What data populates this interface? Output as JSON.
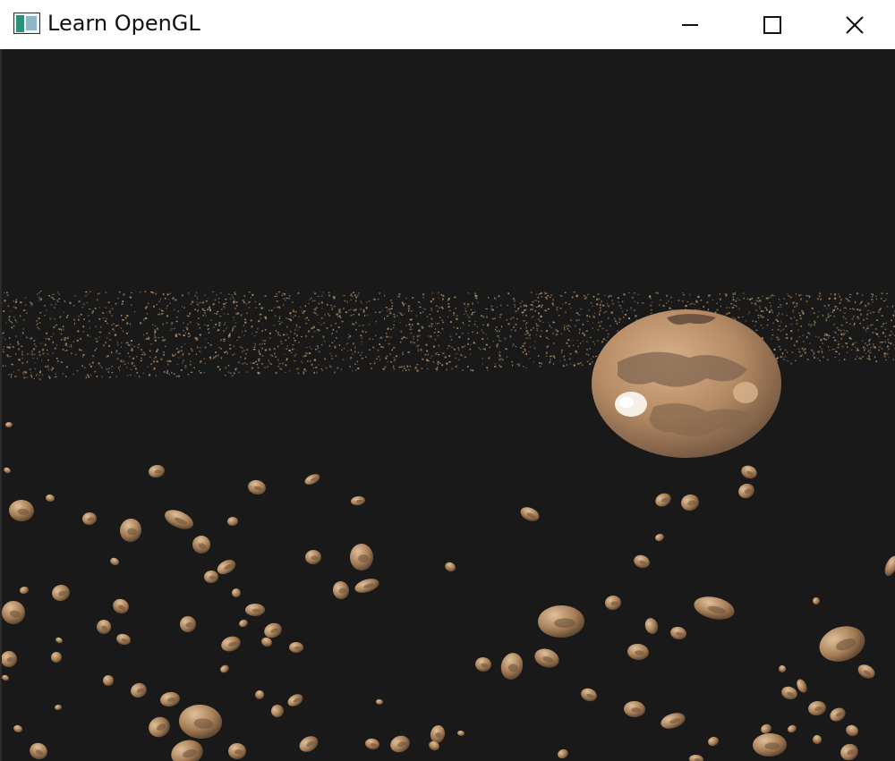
{
  "window": {
    "title": "Learn OpenGL",
    "controls": {
      "minimize_icon": "minimize-icon",
      "maximize_icon": "maximize-icon",
      "close_icon": "close-icon"
    }
  },
  "scene": {
    "background_color": "#191919",
    "asteroid_color": "#b8926a",
    "planet_color": "#c8a27d"
  }
}
